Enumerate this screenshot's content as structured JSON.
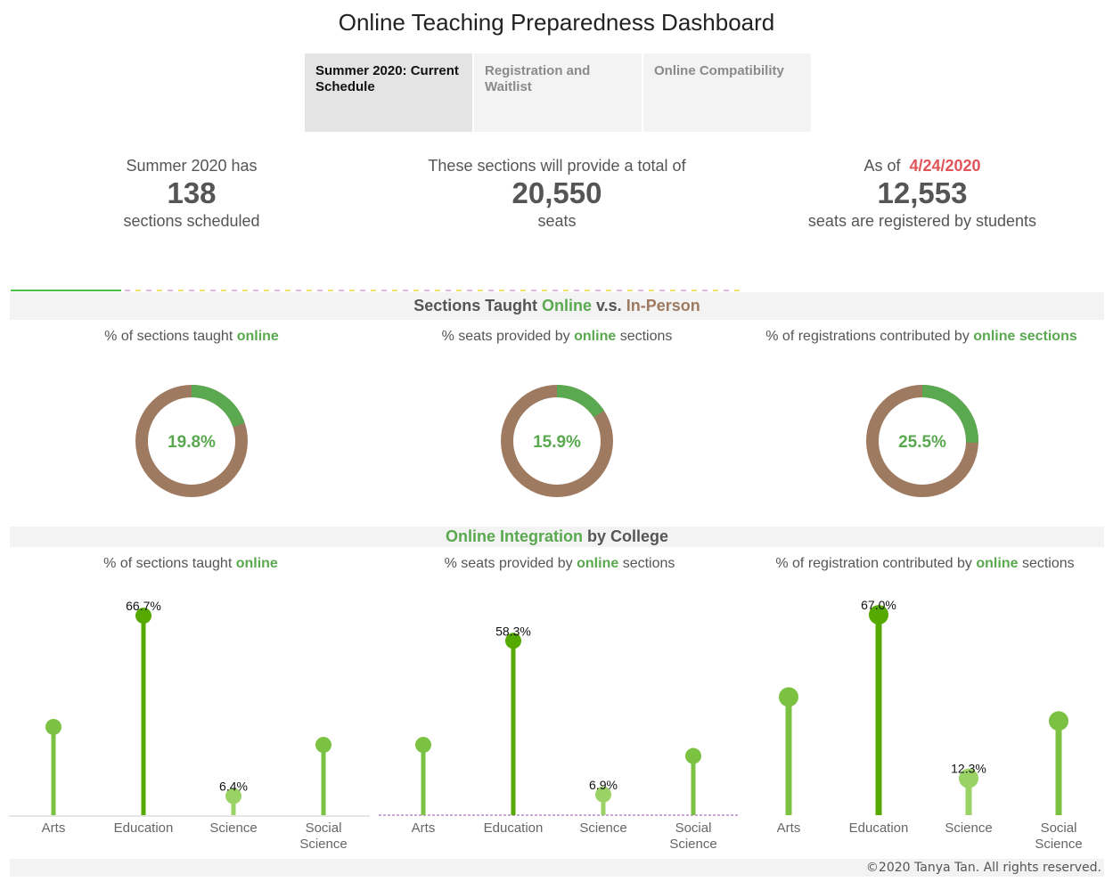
{
  "header": {
    "title": "Online Teaching Preparedness Dashboard"
  },
  "tabs": [
    {
      "label": "Summer 2020: Current Schedule",
      "active": true
    },
    {
      "label": "Registration and Waitlist",
      "active": false
    },
    {
      "label": "Online Compatibility",
      "active": false
    }
  ],
  "kpis": {
    "sections": {
      "pre": "Summer 2020 has",
      "value": "138",
      "post": "sections scheduled"
    },
    "seats": {
      "pre": "These sections will provide a total of",
      "value": "20,550",
      "post": "seats"
    },
    "registered": {
      "pre": "As of",
      "date": "4/24/2020",
      "value": "12,553",
      "post": "seats are registered by students"
    }
  },
  "band1": {
    "part1": "Sections Taught",
    "part2": "Online",
    "part3": "v.s.",
    "part4": "In-Person"
  },
  "band2": {
    "part1": "Online Integration",
    "part2": "by College"
  },
  "donut_titles": [
    {
      "pre": "% of sections taught",
      "bold": "online",
      "post": ""
    },
    {
      "pre": "% seats provided by",
      "bold": "online",
      "post": "sections"
    },
    {
      "pre": "% of registrations contributed by",
      "bold": "online sections",
      "post": ""
    }
  ],
  "lollipop_titles": [
    {
      "pre": "% of sections taught",
      "bold": "online",
      "post": ""
    },
    {
      "pre": "% seats provided by",
      "bold": "online",
      "post": "sections"
    },
    {
      "pre": "% of  registration contributed by",
      "bold": "online",
      "post": "sections"
    }
  ],
  "colors": {
    "online": "#5aa84f",
    "in_person": "#9e7a61",
    "lollipop_light": "#7cc242",
    "lollipop_dark": "#55a900",
    "lollipop_pale": "#9bd266",
    "date": "#e0555a"
  },
  "footer": {
    "text": "©2020 Tanya Tan. All rights reserved."
  },
  "chart_data": [
    {
      "type": "pie",
      "title": "% of sections taught online",
      "categories": [
        "Online",
        "In-Person"
      ],
      "values": [
        19.8,
        80.2
      ],
      "center_label": "19.8%"
    },
    {
      "type": "pie",
      "title": "% seats provided by online sections",
      "categories": [
        "Online",
        "In-Person"
      ],
      "values": [
        15.9,
        84.1
      ],
      "center_label": "15.9%"
    },
    {
      "type": "pie",
      "title": "% of registrations contributed by online sections",
      "categories": [
        "Online",
        "In-Person"
      ],
      "values": [
        25.5,
        74.5
      ],
      "center_label": "25.5%"
    },
    {
      "type": "scatter",
      "subtype": "lollipop",
      "title": "% of sections taught online",
      "categories": [
        "Arts",
        "Education",
        "Science",
        "Social Science"
      ],
      "values": [
        29.5,
        66.7,
        6.4,
        23.5
      ],
      "labels": [
        "",
        "66.7%",
        "6.4%",
        ""
      ],
      "ylim": [
        0,
        70
      ]
    },
    {
      "type": "scatter",
      "subtype": "lollipop",
      "title": "% seats provided by online sections",
      "categories": [
        "Arts",
        "Education",
        "Science",
        "Social Science"
      ],
      "values": [
        23.5,
        58.3,
        6.9,
        19.8
      ],
      "labels": [
        "",
        "58.3%",
        "6.9%",
        ""
      ],
      "ylim": [
        0,
        70
      ]
    },
    {
      "type": "scatter",
      "subtype": "lollipop",
      "title": "% of  registration contributed by online sections",
      "categories": [
        "Arts",
        "Education",
        "Science",
        "Social Science"
      ],
      "values": [
        39.5,
        67.0,
        12.3,
        31.5
      ],
      "labels": [
        "",
        "67.0%",
        "12.3%",
        ""
      ],
      "ylim": [
        0,
        70
      ]
    }
  ]
}
